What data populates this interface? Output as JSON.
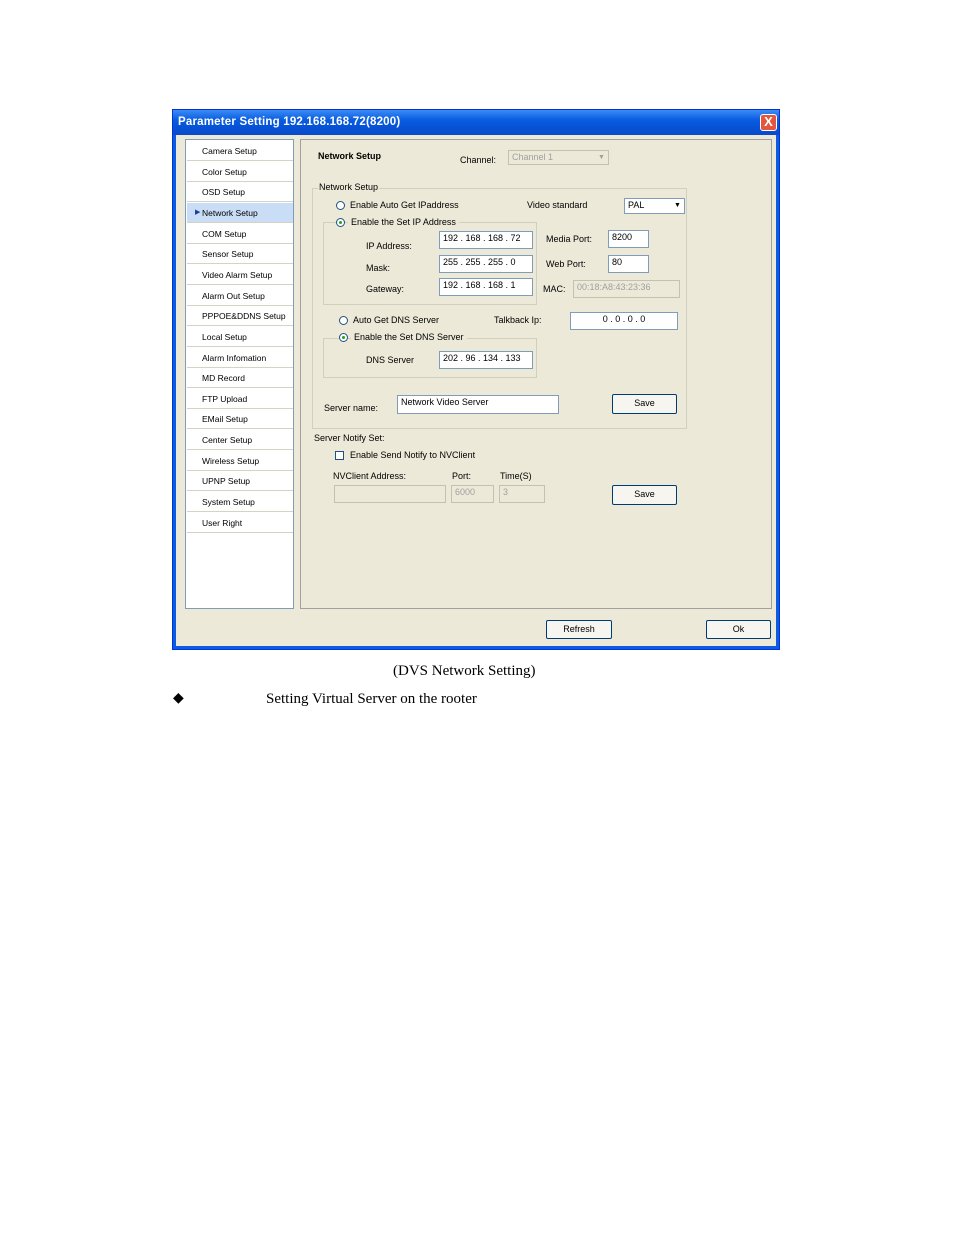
{
  "window": {
    "title": "Parameter Setting 192.168.168.72(8200)",
    "close": "X"
  },
  "sidebar": {
    "items": [
      {
        "label": "Camera Setup"
      },
      {
        "label": "Color Setup"
      },
      {
        "label": "OSD Setup"
      },
      {
        "label": "Network Setup"
      },
      {
        "label": "COM Setup"
      },
      {
        "label": "Sensor Setup"
      },
      {
        "label": "Video Alarm Setup"
      },
      {
        "label": "Alarm Out Setup"
      },
      {
        "label": "PPPOE&DDNS Setup"
      },
      {
        "label": "Local Setup"
      },
      {
        "label": "Alarm Infomation"
      },
      {
        "label": "MD Record"
      },
      {
        "label": "FTP Upload"
      },
      {
        "label": "EMail Setup"
      },
      {
        "label": "Center Setup"
      },
      {
        "label": "Wireless Setup"
      },
      {
        "label": "UPNP Setup"
      },
      {
        "label": "System Setup"
      },
      {
        "label": "User Right"
      }
    ],
    "active_index": 3
  },
  "header": {
    "title": "Network Setup",
    "channel_label": "Channel:",
    "channel_value": "Channel 1"
  },
  "network": {
    "group_label": "Network Setup",
    "auto_ip_label": "Enable Auto Get IPaddress",
    "set_ip_label": "Enable the Set IP Address",
    "ip_label": "IP Address:",
    "ip_value": "192 . 168 . 168 . 72",
    "mask_label": "Mask:",
    "mask_value": "255 . 255 . 255 .  0",
    "gateway_label": "Gateway:",
    "gateway_value": "192 . 168 . 168 .  1",
    "video_standard_label": "Video standard",
    "video_standard_value": "PAL",
    "media_port_label": "Media Port:",
    "media_port_value": "8200",
    "web_port_label": "Web Port:",
    "web_port_value": "80",
    "mac_label": "MAC:",
    "mac_value": "00:18:A8:43:23:36",
    "auto_dns_label": "Auto Get DNS Server",
    "set_dns_label": "Enable the Set DNS Server",
    "dns_label": "DNS Server",
    "dns_value": "202 . 96 . 134 . 133",
    "talkback_label": "Talkback Ip:",
    "talkback_value": "0  .  0  .  0  .  0",
    "server_name_label": "Server name:",
    "server_name_value": "Network Video Server",
    "save_label": "Save"
  },
  "notify": {
    "group_label": "Server Notify Set:",
    "enable_label": "Enable Send Notify to NVClient",
    "address_label": "NVClient Address:",
    "address_value": "",
    "port_label": "Port:",
    "port_value": "6000",
    "time_label": "Time(S)",
    "time_value": "3",
    "save_label": "Save"
  },
  "footer": {
    "refresh_label": "Refresh",
    "ok_label": "Ok"
  },
  "document": {
    "caption": "(DVS Network Setting)",
    "bullet": "◆",
    "bullet_text": "Setting Virtual Server on the rooter"
  }
}
